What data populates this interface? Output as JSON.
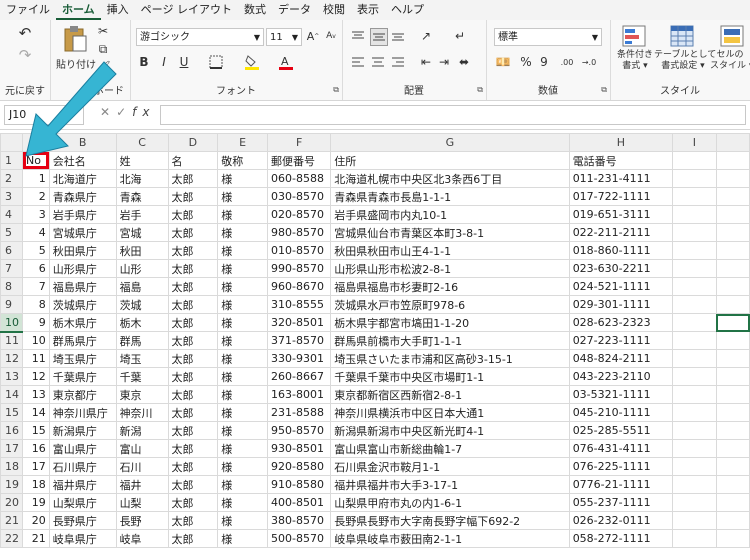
{
  "menu": {
    "tabs": [
      "ファイル",
      "ホーム",
      "挿入",
      "ページ レイアウト",
      "数式",
      "データ",
      "校閲",
      "表示",
      "ヘルプ"
    ],
    "active": 1
  },
  "ribbon": {
    "undo_label": "元に戻す",
    "paste_label": "貼り付け",
    "clipboard_label": "ボード",
    "font_name": "游ゴシック",
    "font_size": "11",
    "font_group_label": "フォント",
    "align_group_label": "配置",
    "number_format": "標準",
    "number_group_label": "数値",
    "style_group_label": "スタイル",
    "cond_format_label": "条件付き\n書式 ▾",
    "table_format_label": "テーブルとして\n書式設定 ▾",
    "cell_style_label": "セルの\nスタイル ▾"
  },
  "formula_bar": {
    "name_box": "J10",
    "formula": ""
  },
  "columns": [
    "A",
    "B",
    "C",
    "D",
    "E",
    "F",
    "G",
    "H",
    "I"
  ],
  "selected_row": 10,
  "rows": [
    {
      "n": "1",
      "a": "No",
      "b": "会社名",
      "c": "姓",
      "d": "名",
      "e": "敬称",
      "f": "郵便番号",
      "g": "住所",
      "h": "電話番号"
    },
    {
      "n": "2",
      "a": "1",
      "b": "北海道庁",
      "c": "北海",
      "d": "太郎",
      "e": "様",
      "f": "060-8588",
      "g": "北海道札幌市中央区北3条西6丁目",
      "h": "011-231-4111"
    },
    {
      "n": "3",
      "a": "2",
      "b": "青森県庁",
      "c": "青森",
      "d": "太郎",
      "e": "様",
      "f": "030-8570",
      "g": "青森県青森市長島1-1-1",
      "h": "017-722-1111"
    },
    {
      "n": "4",
      "a": "3",
      "b": "岩手県庁",
      "c": "岩手",
      "d": "太郎",
      "e": "様",
      "f": "020-8570",
      "g": "岩手県盛岡市内丸10-1",
      "h": "019-651-3111"
    },
    {
      "n": "5",
      "a": "4",
      "b": "宮城県庁",
      "c": "宮城",
      "d": "太郎",
      "e": "様",
      "f": "980-8570",
      "g": "宮城県仙台市青葉区本町3-8-1",
      "h": "022-211-2111"
    },
    {
      "n": "6",
      "a": "5",
      "b": "秋田県庁",
      "c": "秋田",
      "d": "太郎",
      "e": "様",
      "f": "010-8570",
      "g": "秋田県秋田市山王4-1-1",
      "h": "018-860-1111"
    },
    {
      "n": "7",
      "a": "6",
      "b": "山形県庁",
      "c": "山形",
      "d": "太郎",
      "e": "様",
      "f": "990-8570",
      "g": "山形県山形市松波2-8-1",
      "h": "023-630-2211"
    },
    {
      "n": "8",
      "a": "7",
      "b": "福島県庁",
      "c": "福島",
      "d": "太郎",
      "e": "様",
      "f": "960-8670",
      "g": "福島県福島市杉妻町2-16",
      "h": "024-521-1111"
    },
    {
      "n": "9",
      "a": "8",
      "b": "茨城県庁",
      "c": "茨城",
      "d": "太郎",
      "e": "様",
      "f": "310-8555",
      "g": "茨城県水戸市笠原町978-6",
      "h": "029-301-1111"
    },
    {
      "n": "10",
      "a": "9",
      "b": "栃木県庁",
      "c": "栃木",
      "d": "太郎",
      "e": "様",
      "f": "320-8501",
      "g": "栃木県宇都宮市塙田1-1-20",
      "h": "028-623-2323"
    },
    {
      "n": "11",
      "a": "10",
      "b": "群馬県庁",
      "c": "群馬",
      "d": "太郎",
      "e": "様",
      "f": "371-8570",
      "g": "群馬県前橋市大手町1-1-1",
      "h": "027-223-1111"
    },
    {
      "n": "12",
      "a": "11",
      "b": "埼玉県庁",
      "c": "埼玉",
      "d": "太郎",
      "e": "様",
      "f": "330-9301",
      "g": "埼玉県さいたま市浦和区高砂3-15-1",
      "h": "048-824-2111"
    },
    {
      "n": "13",
      "a": "12",
      "b": "千葉県庁",
      "c": "千葉",
      "d": "太郎",
      "e": "様",
      "f": "260-8667",
      "g": "千葉県千葉市中央区市場町1-1",
      "h": "043-223-2110"
    },
    {
      "n": "14",
      "a": "13",
      "b": "東京都庁",
      "c": "東京",
      "d": "太郎",
      "e": "様",
      "f": "163-8001",
      "g": "東京都新宿区西新宿2-8-1",
      "h": "03-5321-1111"
    },
    {
      "n": "15",
      "a": "14",
      "b": "神奈川県庁",
      "c": "神奈川",
      "d": "太郎",
      "e": "様",
      "f": "231-8588",
      "g": "神奈川県横浜市中区日本大通1",
      "h": "045-210-1111"
    },
    {
      "n": "16",
      "a": "15",
      "b": "新潟県庁",
      "c": "新潟",
      "d": "太郎",
      "e": "様",
      "f": "950-8570",
      "g": "新潟県新潟市中央区新光町4-1",
      "h": "025-285-5511"
    },
    {
      "n": "17",
      "a": "16",
      "b": "富山県庁",
      "c": "富山",
      "d": "太郎",
      "e": "様",
      "f": "930-8501",
      "g": "富山県富山市新総曲輪1-7",
      "h": "076-431-4111"
    },
    {
      "n": "18",
      "a": "17",
      "b": "石川県庁",
      "c": "石川",
      "d": "太郎",
      "e": "様",
      "f": "920-8580",
      "g": "石川県金沢市鞍月1-1",
      "h": "076-225-1111"
    },
    {
      "n": "19",
      "a": "18",
      "b": "福井県庁",
      "c": "福井",
      "d": "太郎",
      "e": "様",
      "f": "910-8580",
      "g": "福井県福井市大手3-17-1",
      "h": "0776-21-1111"
    },
    {
      "n": "20",
      "a": "19",
      "b": "山梨県庁",
      "c": "山梨",
      "d": "太郎",
      "e": "様",
      "f": "400-8501",
      "g": "山梨県甲府市丸の内1-6-1",
      "h": "055-237-1111"
    },
    {
      "n": "21",
      "a": "20",
      "b": "長野県庁",
      "c": "長野",
      "d": "太郎",
      "e": "様",
      "f": "380-8570",
      "g": "長野県長野市大字南長野字幅下692-2",
      "h": "026-232-0111"
    },
    {
      "n": "22",
      "a": "21",
      "b": "岐阜県庁",
      "c": "岐阜",
      "d": "太郎",
      "e": "様",
      "f": "500-8570",
      "g": "岐阜県岐阜市薮田南2-1-1",
      "h": "058-272-1111"
    }
  ],
  "colors": {
    "accent": "#217346",
    "annotation": "#e60012",
    "arrow": "#36b5d3"
  }
}
